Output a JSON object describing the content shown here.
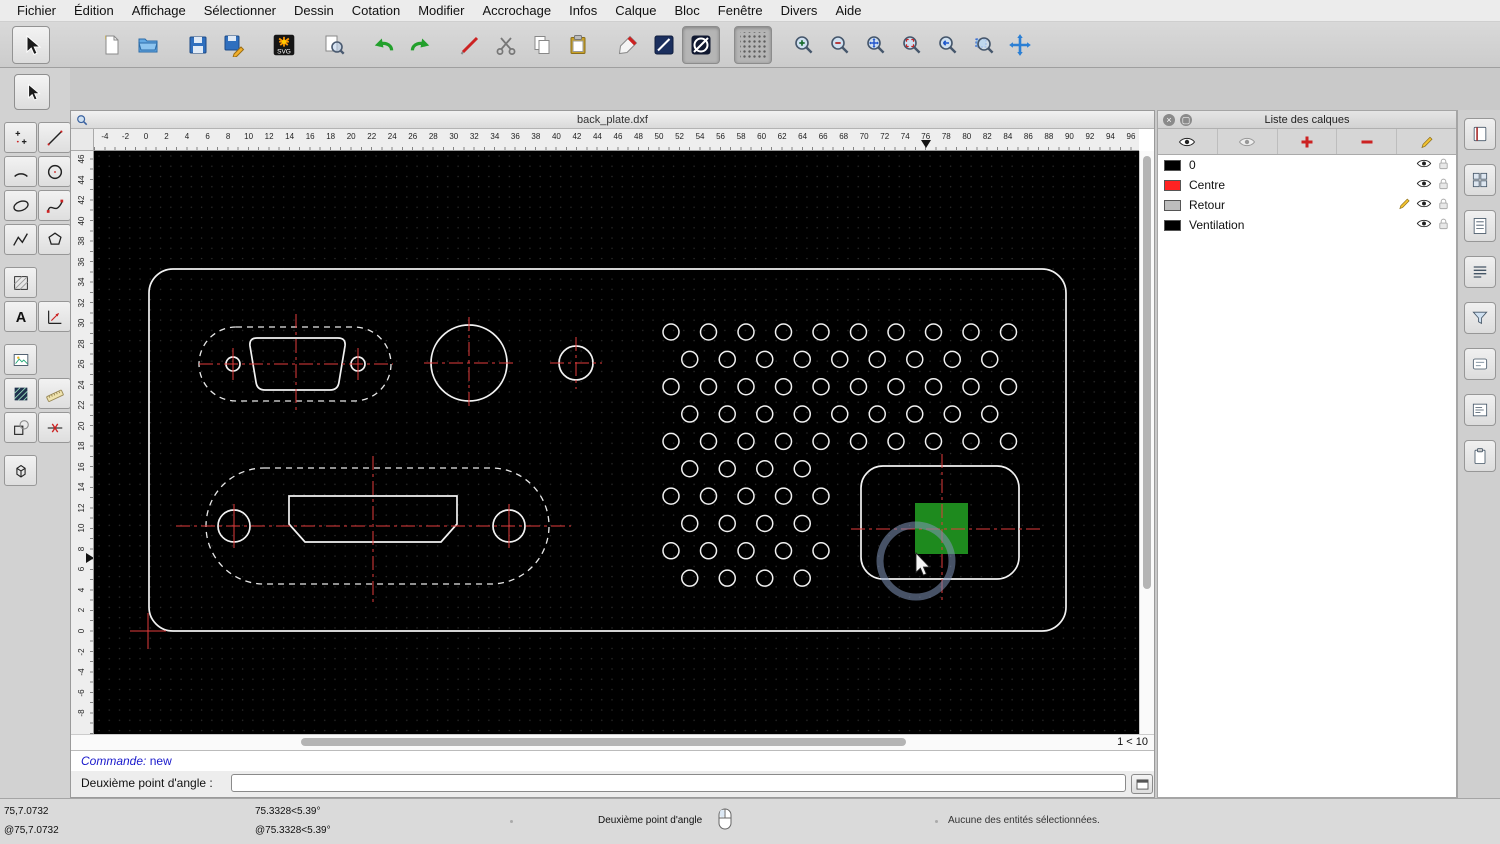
{
  "menu": {
    "items": [
      "Fichier",
      "Édition",
      "Affichage",
      "Sélectionner",
      "Dessin",
      "Cotation",
      "Modifier",
      "Accrochage",
      "Infos",
      "Calque",
      "Bloc",
      "Fenêtre",
      "Divers",
      "Aide"
    ]
  },
  "toolbar": {
    "buttons": [
      "select",
      "new-document",
      "open",
      "save",
      "save-as",
      "svg-export",
      "print-preview",
      "undo",
      "redo",
      "delete",
      "cut",
      "copy",
      "paste",
      "draft-pen",
      "attributes",
      "construction-circle",
      "grid-toggle",
      "zoom-in",
      "zoom-out",
      "zoom-auto",
      "zoom-selection",
      "zoom-previous",
      "zoom-window",
      "zoom-pan"
    ],
    "active_buttons": [
      "construction-circle",
      "grid-toggle"
    ]
  },
  "left_palette": {
    "tools": [
      "select",
      "points",
      "line",
      "arc",
      "circle",
      "ellipse",
      "spline",
      "polyline",
      "polygon",
      "hatch",
      "text",
      "dimension",
      "image",
      "fill",
      "measure",
      "modify",
      "explode",
      "solid"
    ]
  },
  "document": {
    "title": "back_plate.dxf",
    "zoom_indicator": "1 < 10",
    "hruler": {
      "min": -4,
      "max": 96,
      "step": 2
    },
    "vruler": {
      "min": -8,
      "max": 46,
      "step": 2
    }
  },
  "command": {
    "history_label": "Commande:",
    "history_value": "new",
    "prompt_label": "Deuxième point d'angle :",
    "input_value": ""
  },
  "layers_panel": {
    "title": "Liste des calques",
    "close_glyph": "×",
    "float_glyph": "▢",
    "layers": [
      {
        "name": "0",
        "color": "#000000",
        "visible": true,
        "locked": false,
        "active": false
      },
      {
        "name": "Centre",
        "color": "#ff2222",
        "visible": true,
        "locked": false,
        "active": false
      },
      {
        "name": "Retour",
        "color": "#bdbdbd",
        "visible": true,
        "locked": false,
        "active": true
      },
      {
        "name": "Ventilation",
        "color": "#000000",
        "visible": true,
        "locked": false,
        "active": false
      }
    ]
  },
  "statusbar": {
    "absolute": "75,7.0732",
    "relative": "@75,7.0732",
    "polar": "75.3328<5.39°",
    "polar_relative": "@75.3328<5.39°",
    "hint": "Deuxième point d'angle",
    "selection": "Aucune des entités sélectionnées."
  },
  "colors": {
    "canvas_bg": "#000000",
    "entity_line": "#f2f2f2",
    "centerline_red": "#e23b3b",
    "selection_green": "#1e8a1e",
    "command_text": "#1a1acc"
  }
}
